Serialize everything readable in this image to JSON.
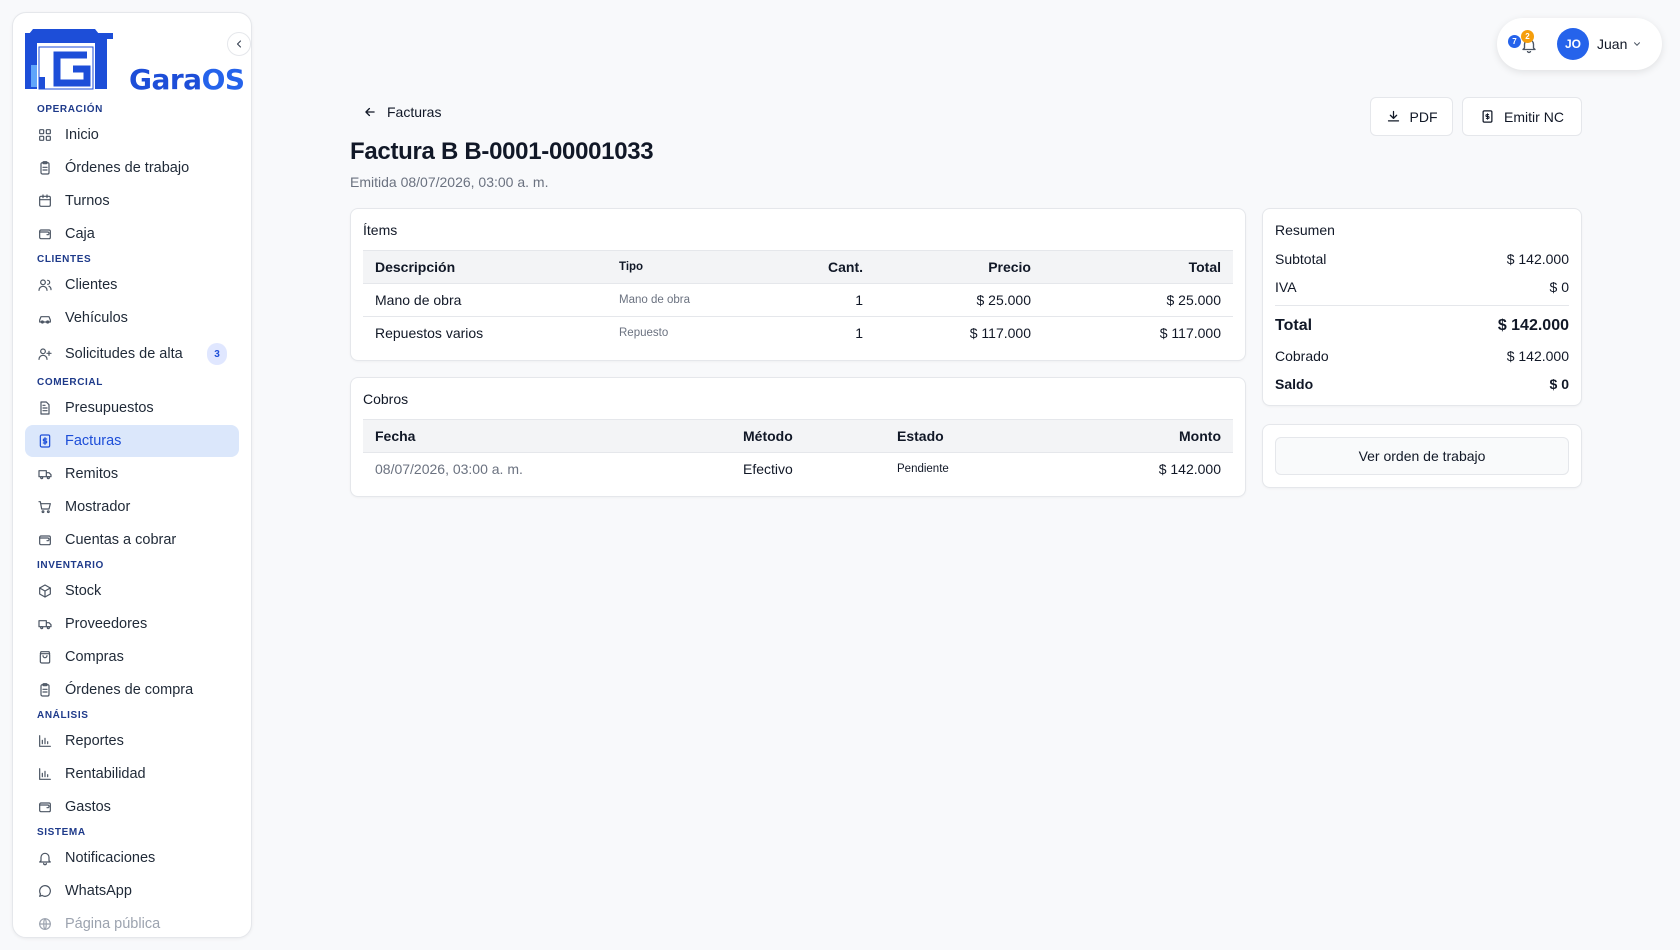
{
  "brand": {
    "name_part1": "Gara",
    "name_part2": "OS",
    "logo_letter": "G"
  },
  "sidebar": {
    "sections": [
      {
        "label": "Operación",
        "items": [
          {
            "label": "Inicio",
            "icon": "grid-icon"
          },
          {
            "label": "Órdenes de trabajo",
            "icon": "clipboard-icon"
          },
          {
            "label": "Turnos",
            "icon": "calendar-icon"
          },
          {
            "label": "Caja",
            "icon": "wallet-icon"
          }
        ]
      },
      {
        "label": "Clientes",
        "items": [
          {
            "label": "Clientes",
            "icon": "users-icon"
          },
          {
            "label": "Vehículos",
            "icon": "car-icon"
          },
          {
            "label": "Solicitudes de alta",
            "icon": "user-plus-icon",
            "badge": "3"
          }
        ]
      },
      {
        "label": "Comercial",
        "items": [
          {
            "label": "Presupuestos",
            "icon": "file-text-icon"
          },
          {
            "label": "Facturas",
            "icon": "invoice-icon",
            "active": true
          },
          {
            "label": "Remitos",
            "icon": "truck-icon"
          },
          {
            "label": "Mostrador",
            "icon": "cart-icon"
          },
          {
            "label": "Cuentas a cobrar",
            "icon": "wallet-icon"
          }
        ]
      },
      {
        "label": "Inventario",
        "items": [
          {
            "label": "Stock",
            "icon": "package-icon"
          },
          {
            "label": "Proveedores",
            "icon": "truck-icon"
          },
          {
            "label": "Compras",
            "icon": "shopping-bag-icon"
          },
          {
            "label": "Órdenes de compra",
            "icon": "clipboard-icon"
          }
        ]
      },
      {
        "label": "Análisis",
        "items": [
          {
            "label": "Reportes",
            "icon": "bar-chart-icon"
          },
          {
            "label": "Rentabilidad",
            "icon": "bar-chart-icon"
          },
          {
            "label": "Gastos",
            "icon": "wallet-icon"
          }
        ]
      },
      {
        "label": "Sistema",
        "items": [
          {
            "label": "Notificaciones",
            "icon": "bell-icon"
          },
          {
            "label": "WhatsApp",
            "icon": "chat-icon"
          },
          {
            "label": "Página pública",
            "icon": "globe-icon",
            "faded": true
          }
        ]
      }
    ]
  },
  "topbar": {
    "notif_badge_blue": "7",
    "notif_badge_amber": "2",
    "user_initials": "JO",
    "user_name": "Juan"
  },
  "header": {
    "back_label": "Facturas",
    "title": "Factura B B-0001-00001033",
    "subtitle": "Emitida 08/07/2026, 03:00 a. m.",
    "pdf_label": "PDF",
    "nc_label": "Emitir NC"
  },
  "items_card": {
    "title": "Ítems",
    "columns": [
      "Descripción",
      "Tipo",
      "Cant.",
      "Precio",
      "Total"
    ],
    "rows": [
      [
        "Mano de obra",
        "Mano de obra",
        "1",
        "$ 25.000",
        "$ 25.000"
      ],
      [
        "Repuestos varios",
        "Repuesto",
        "1",
        "$ 117.000",
        "$ 117.000"
      ]
    ]
  },
  "cobros_card": {
    "title": "Cobros",
    "columns": [
      "Fecha",
      "Método",
      "Estado",
      "Monto"
    ],
    "rows": [
      [
        "08/07/2026, 03:00 a. m.",
        "Efectivo",
        "Pendiente",
        "$ 142.000"
      ]
    ]
  },
  "summary": {
    "title": "Resumen",
    "subtotal_label": "Subtotal",
    "subtotal_value": "$ 142.000",
    "iva_label": "IVA",
    "iva_value": "$ 0",
    "total_label": "Total",
    "total_value": "$ 142.000",
    "cobrado_label": "Cobrado",
    "cobrado_value": "$ 142.000",
    "saldo_label": "Saldo",
    "saldo_value": "$ 0"
  },
  "order_button": {
    "label": "Ver orden de trabajo"
  },
  "colors": {
    "accent": "#2563eb",
    "active_bg": "#dbe7fb",
    "badge_amber": "#f59e0b"
  }
}
